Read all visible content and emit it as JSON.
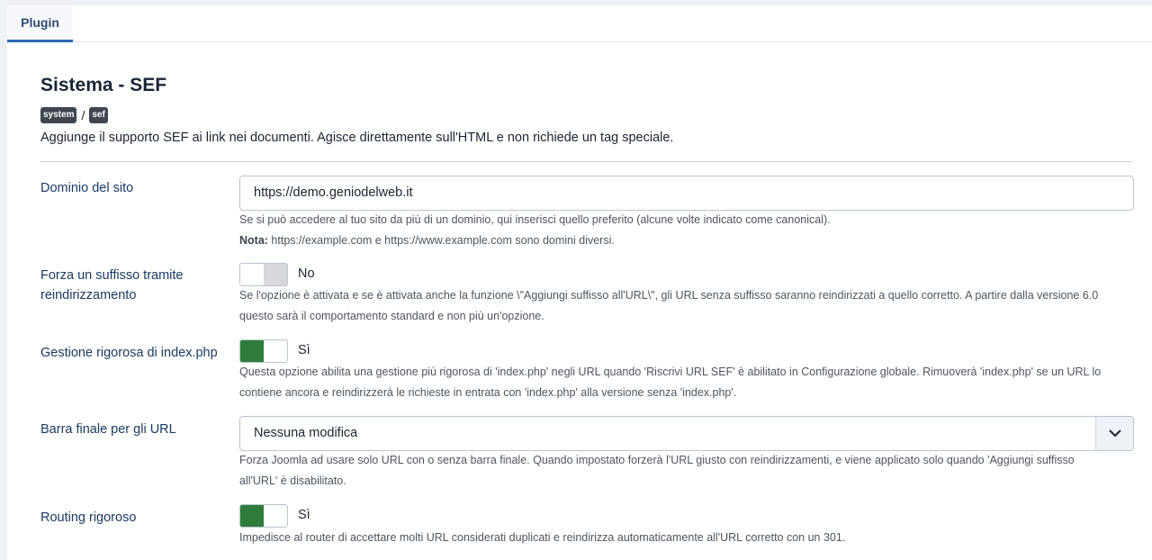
{
  "tabs": [
    {
      "label": "Plugin"
    }
  ],
  "plugin": {
    "title": "Sistema - SEF",
    "badge_group": "system",
    "badge_element": "sef",
    "separator": "/",
    "description": "Aggiunge il supporto SEF ai link nei documenti. Agisce direttamente sull'HTML e non richiede un tag speciale."
  },
  "fields": {
    "domain": {
      "label": "Dominio del sito",
      "value": "https://demo.geniodelweb.it",
      "help": "Se si può accedere al tuo sito da più di un dominio, qui inserisci quello preferito (alcune volte indicato come canonical).",
      "note_label": "Nota:",
      "note_text": " https://example.com e https://www.example.com sono domini diversi."
    },
    "force_suffix": {
      "label_line1": "Forza un suffisso tramite",
      "label_line2": "reindirizzamento",
      "state_label": "No",
      "checked": false,
      "help_line1": "Se l'opzione è attivata e se è attivata anche la funzione \\\"Aggiungi suffisso all'URL\\\", gli URL senza suffisso saranno reindirizzati a quello corretto. A partire dalla versione 6.0",
      "help_line2": "questo sarà il comportamento standard e non più un'opzione."
    },
    "strict_index": {
      "label": "Gestione rigorosa di index.php",
      "state_label": "Sì",
      "checked": true,
      "help_line1": "Questa opzione abilita una gestione più rigorosa di 'index.php' negli URL quando 'Riscrivi URL SEF' è abilitato in Configurazione globale. Rimuoverà 'index.php' se un URL lo",
      "help_line2": "contiene ancora e reindirizzerà le richieste in entrata con 'index.php' alla versione senza 'index.php'."
    },
    "trailing_slash": {
      "label": "Barra finale per gli URL",
      "selected": "Nessuna modifica",
      "help_line1": "Forza Joomla ad usare solo URL con o senza barra finale. Quando impostato forzerà l'URL giusto con reindirizzamenti, e viene applicato solo quando 'Aggiungi suffisso",
      "help_line2": "all'URL' è disabilitato."
    },
    "strict_routing": {
      "label": "Routing rigoroso",
      "state_label": "Sì",
      "checked": true,
      "help": "Impedisce al router di accettare molti URL considerati duplicati e reindirizza automaticamente all'URL corretto con un 301."
    }
  },
  "colors": {
    "accent": "#2a69b8",
    "switch_on": "#2e7d3a",
    "badge": "#3f4650"
  }
}
